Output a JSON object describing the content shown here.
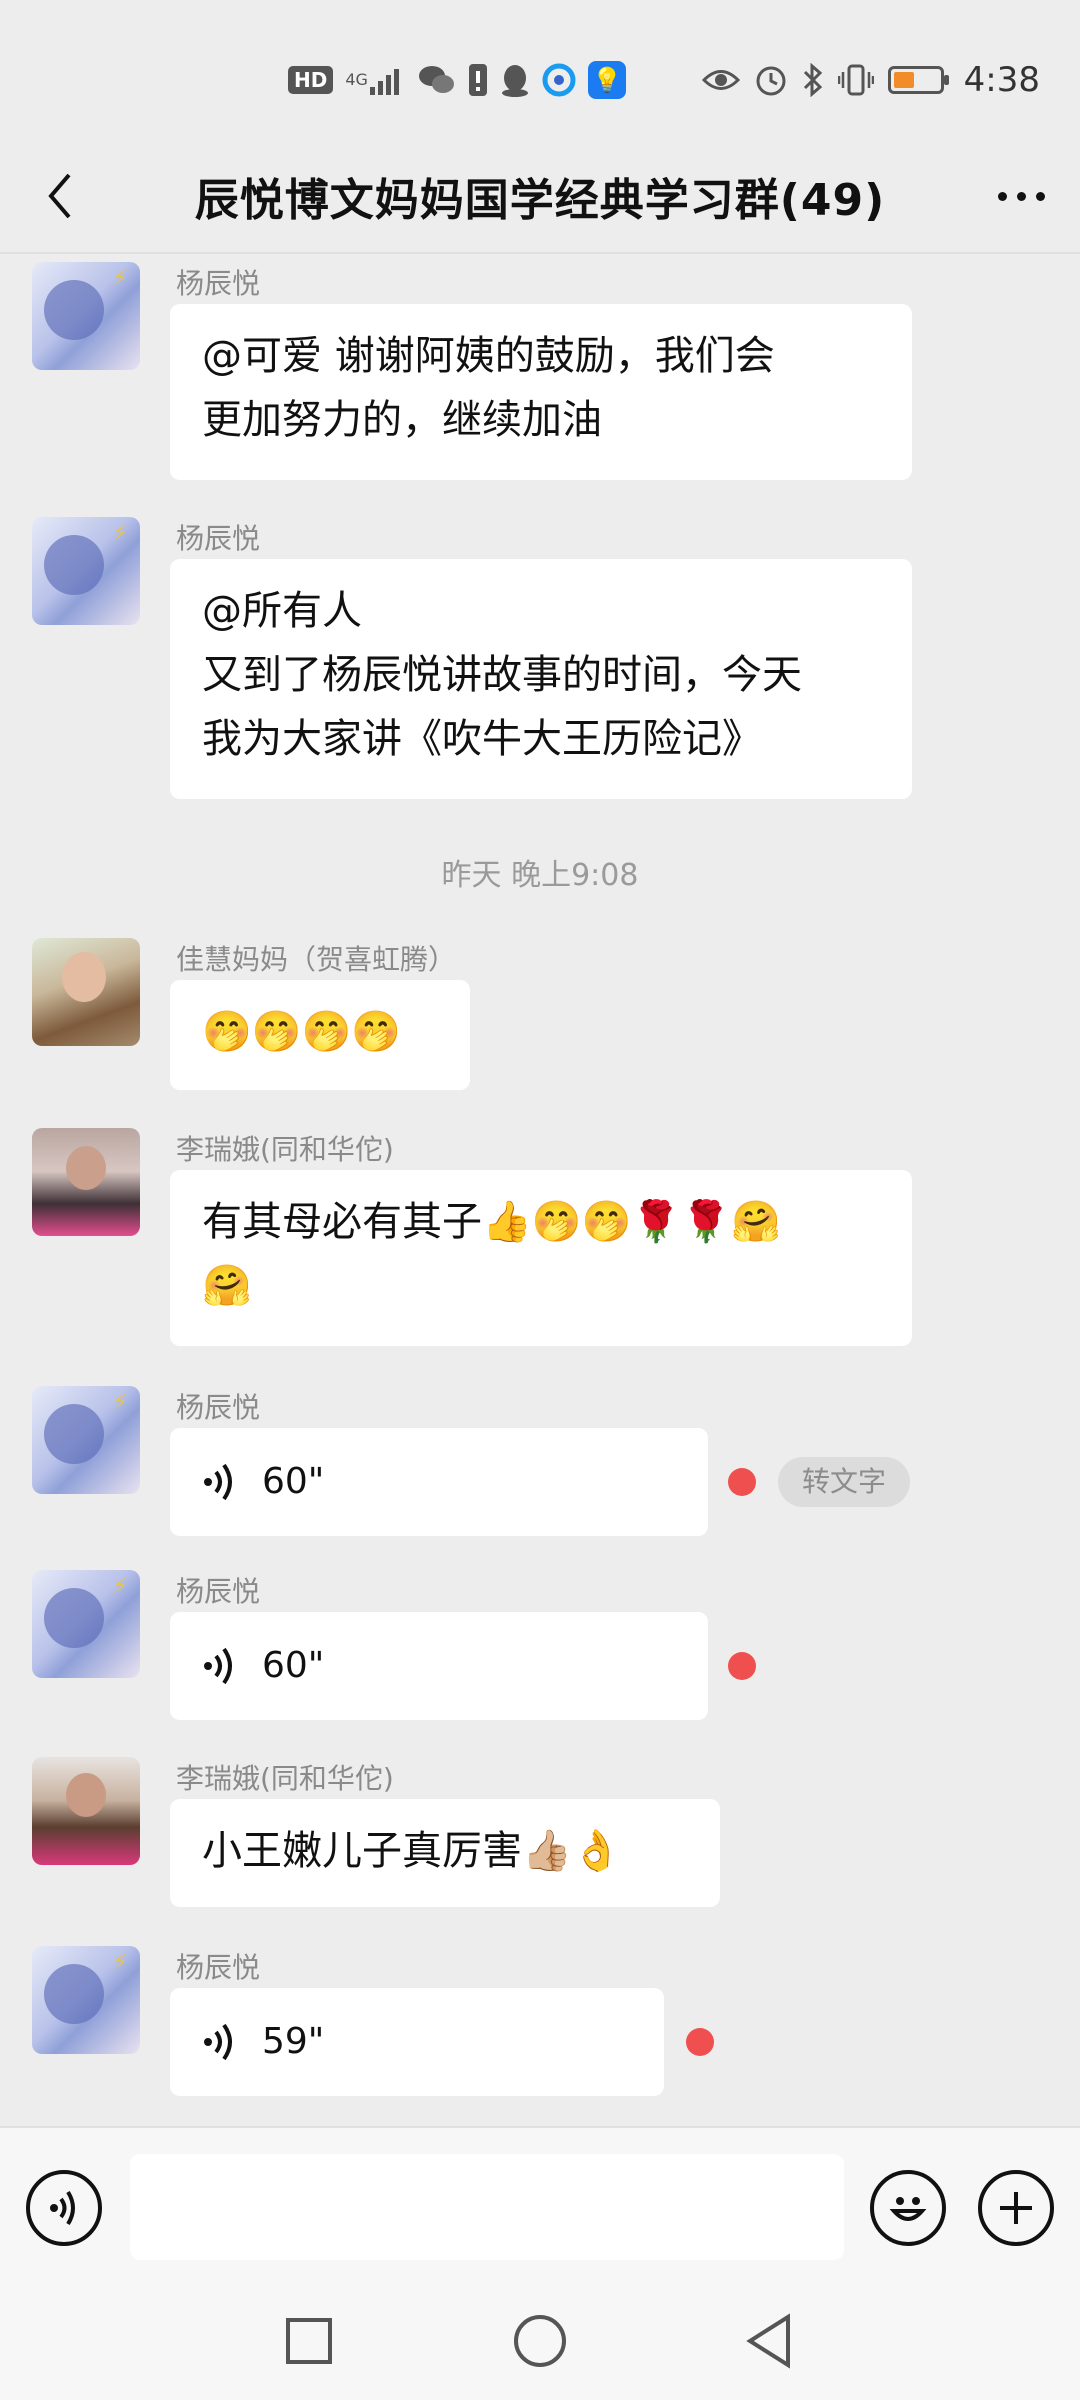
{
  "status_bar": {
    "network_badge": "HD",
    "network_type": "4G",
    "time": "4:38",
    "battery_percent": 40,
    "icons": [
      "hd-icon",
      "signal-4g-icon",
      "wechat-icon",
      "alert-icon",
      "qq-icon",
      "browser-icon",
      "lightbulb-app-icon",
      "eye-icon",
      "alarm-icon",
      "bluetooth-icon",
      "vibrate-icon",
      "battery-icon"
    ]
  },
  "header": {
    "title": "辰悦博文妈妈国学经典学习群(49)"
  },
  "messages": [
    {
      "sender": "杨辰悦",
      "type": "text",
      "lines": [
        "@可爱  谢谢阿姨的鼓励，我们会",
        "更加努力的，继续加油"
      ]
    },
    {
      "sender": "杨辰悦",
      "type": "text",
      "lines": [
        "@所有人",
        "又到了杨辰悦讲故事的时间，今天",
        "我为大家讲《吹牛大王历险记》"
      ]
    },
    {
      "type": "time",
      "text": "昨天 晚上9:08"
    },
    {
      "sender": "佳慧妈妈（贺喜虹腾）",
      "type": "text",
      "lines": [
        "🤭🤭🤭🤭"
      ]
    },
    {
      "sender": "李瑞娥(同和华佗)",
      "type": "text",
      "lines": [
        "有其母必有其子👍🤭🤭🌹🌹🤗",
        "🤗"
      ]
    },
    {
      "sender": "杨辰悦",
      "type": "voice",
      "duration": "60\"",
      "unread": true,
      "transcribe_label": "转文字"
    },
    {
      "sender": "杨辰悦",
      "type": "voice",
      "duration": "60\"",
      "unread": true
    },
    {
      "sender": "李瑞娥(同和华佗)",
      "type": "text",
      "lines": [
        "小王嫩儿子真厉害👍🏼👌"
      ]
    },
    {
      "sender": "杨辰悦",
      "type": "voice",
      "duration": "59\"",
      "unread": true
    }
  ],
  "input_bar": {
    "placeholder": "",
    "icons": [
      "voice-input-icon",
      "emoji-icon",
      "plus-icon"
    ]
  },
  "nav_bar": {
    "icons": [
      "recent-apps-icon",
      "home-icon",
      "back-icon"
    ]
  }
}
